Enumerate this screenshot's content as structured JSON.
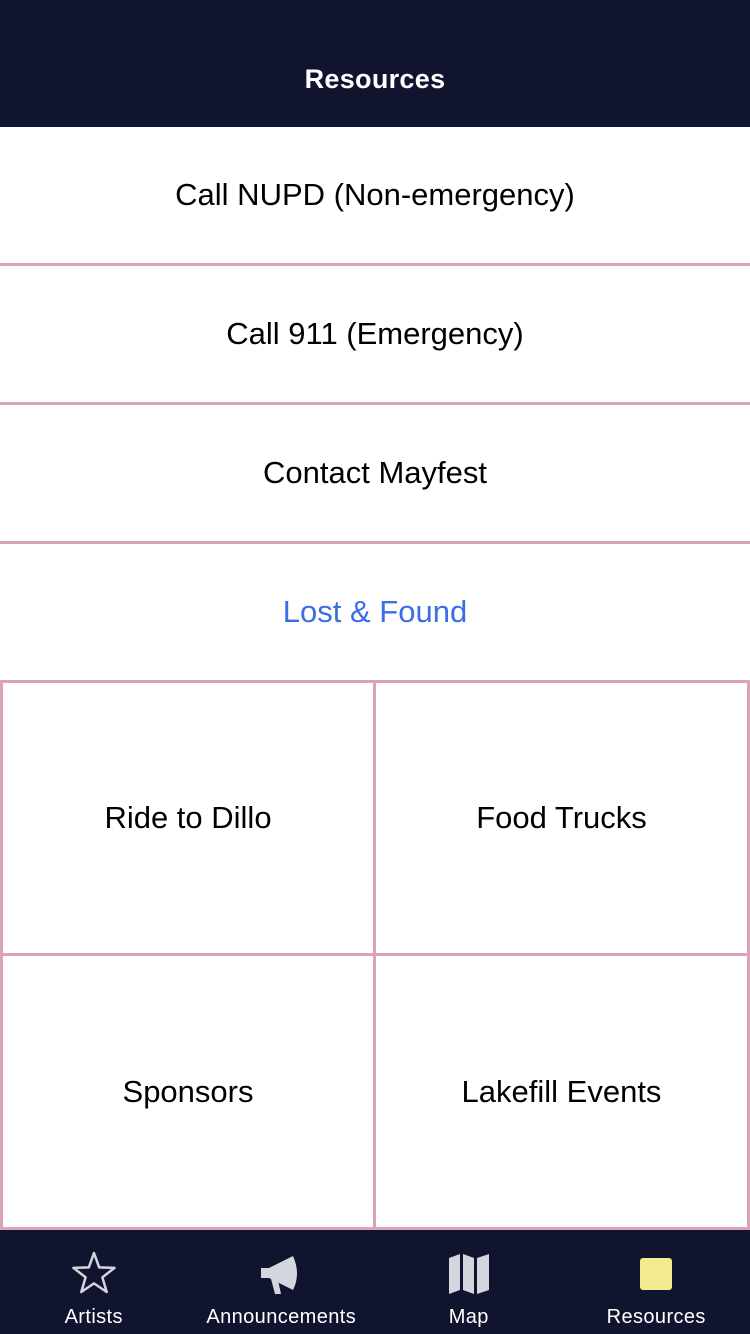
{
  "header": {
    "title": "Resources"
  },
  "list": {
    "call_nupd": "Call NUPD (Non-emergency)",
    "call_911": "Call 911 (Emergency)",
    "contact_mayfest": "Contact Mayfest",
    "lost_found": "Lost & Found"
  },
  "grid": {
    "ride_to_dillo": "Ride to Dillo",
    "food_trucks": "Food Trucks",
    "sponsors": "Sponsors",
    "lakefill_events": "Lakefill Events"
  },
  "tabs": [
    {
      "label": "Artists",
      "icon": "star-icon",
      "selected": false
    },
    {
      "label": "Announcements",
      "icon": "megaphone-icon",
      "selected": false
    },
    {
      "label": "Map",
      "icon": "map-icon",
      "selected": false
    },
    {
      "label": "Resources",
      "icon": "square-icon",
      "selected": true
    }
  ],
  "colors": {
    "nav_background": "#11142f",
    "divider": "#d9a3bb",
    "link": "#3a6de8",
    "selected_tab_icon": "#f2ec8f",
    "tab_icon": "#d4d6de"
  }
}
